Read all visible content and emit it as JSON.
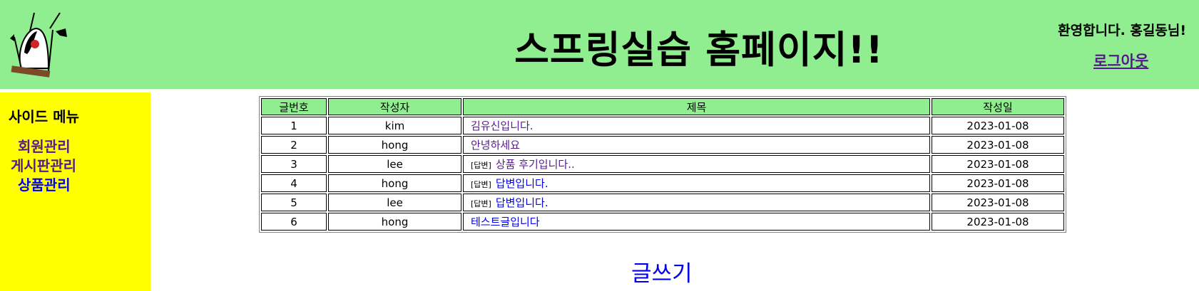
{
  "header": {
    "site_title": "스프링실습 홈페이지!!",
    "welcome_text": "환영합니다. 홍길동님!",
    "logout_label": "로그아웃"
  },
  "sidebar": {
    "title": "사이드 메뉴",
    "items": [
      {
        "label": "회원관리"
      },
      {
        "label": "게시판관리"
      },
      {
        "label": "상품관리"
      }
    ]
  },
  "board": {
    "columns": [
      "글번호",
      "작성자",
      "제목",
      "작성일"
    ],
    "reply_tag": "[답변]",
    "rows": [
      {
        "no": "1",
        "writer": "kim",
        "title": "김유신입니다.",
        "date": "2023-01-08",
        "level": 0,
        "visited": true
      },
      {
        "no": "2",
        "writer": "hong",
        "title": "안녕하세요",
        "date": "2023-01-08",
        "level": 0,
        "visited": true
      },
      {
        "no": "3",
        "writer": "lee",
        "title": "상품 후기입니다..",
        "date": "2023-01-08",
        "level": 1,
        "visited": true
      },
      {
        "no": "4",
        "writer": "hong",
        "title": "답변입니다.",
        "date": "2023-01-08",
        "level": 1,
        "visited": false
      },
      {
        "no": "5",
        "writer": "lee",
        "title": "답변입니다.",
        "date": "2023-01-08",
        "level": 2,
        "visited": false
      },
      {
        "no": "6",
        "writer": "hong",
        "title": "테스트글입니다",
        "date": "2023-01-08",
        "level": 0,
        "visited": false
      }
    ]
  },
  "write_label": "글쓰기",
  "icons": {
    "logo": "duke-mascot-icon"
  }
}
